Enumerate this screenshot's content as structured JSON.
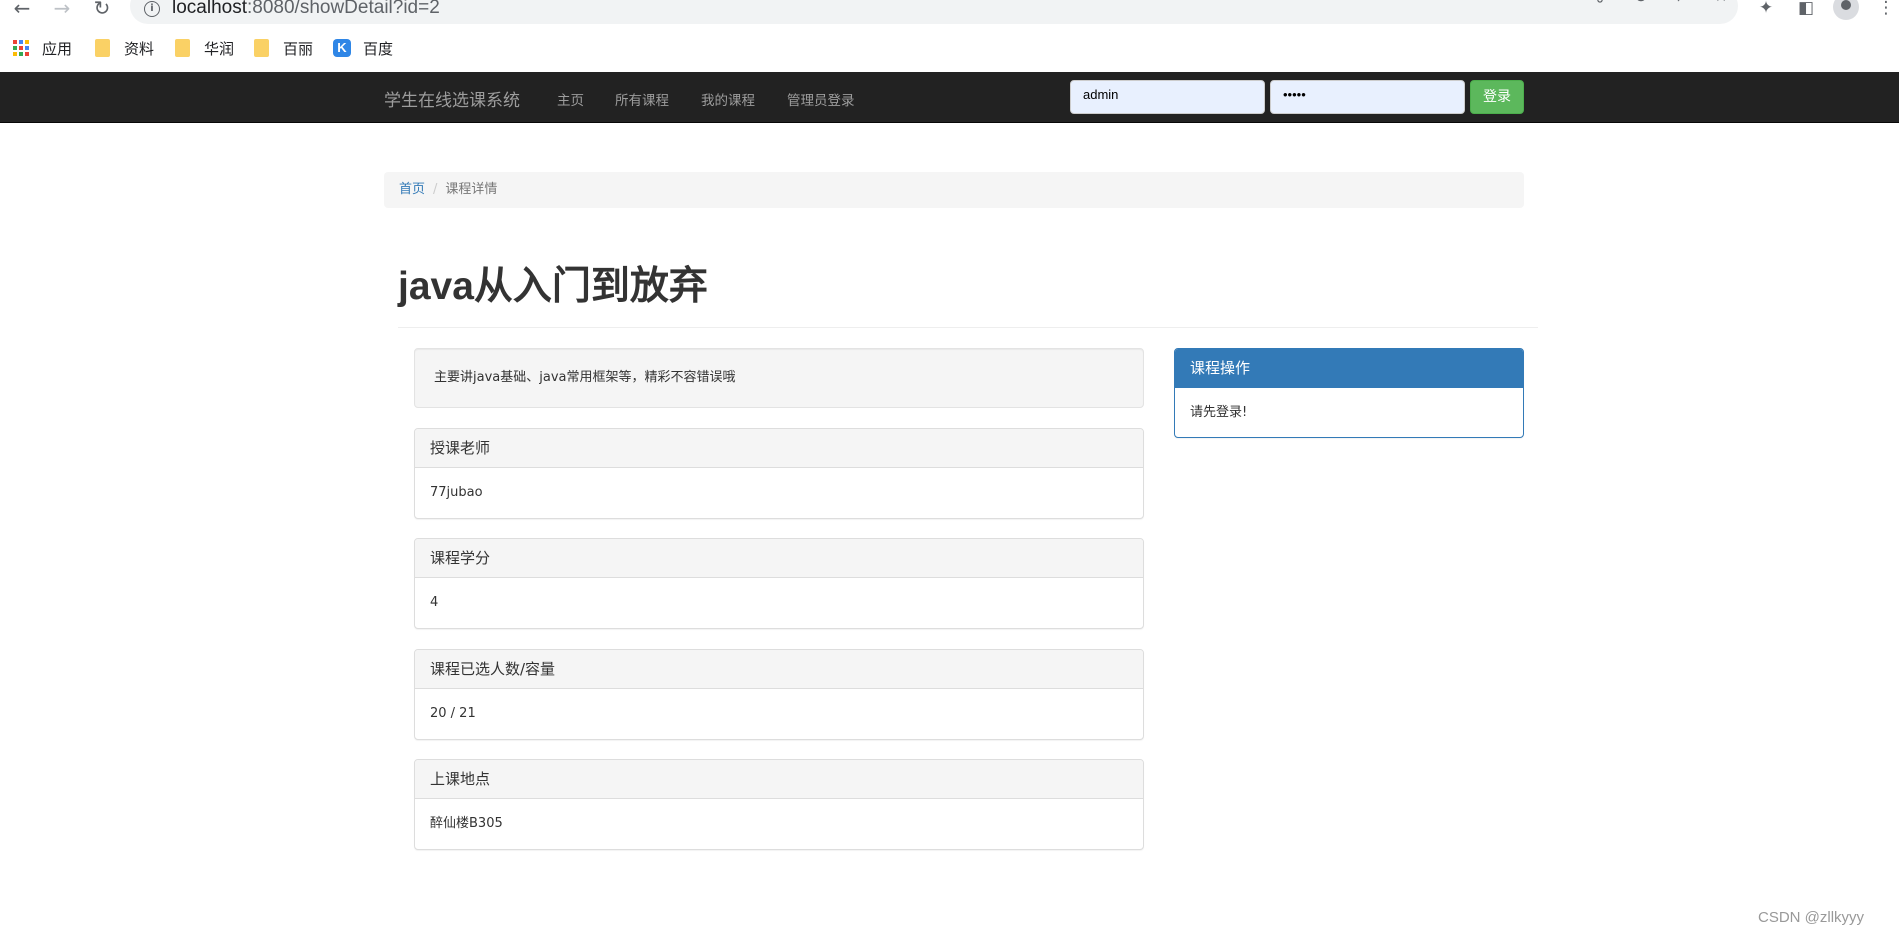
{
  "browser": {
    "url_host": "localhost",
    "url_rest": ":8080/showDetail?id=2",
    "bookmarks": [
      {
        "label": "应用",
        "icon": "apps-grid-icon"
      },
      {
        "label": "资料",
        "icon": "folder-icon"
      },
      {
        "label": "华润",
        "icon": "folder-icon"
      },
      {
        "label": "百丽",
        "icon": "folder-icon"
      },
      {
        "label": "百度",
        "icon": "k-logo-icon"
      }
    ]
  },
  "navbar": {
    "brand": "学生在线选课系统",
    "links": [
      "主页",
      "所有课程",
      "我的课程",
      "管理员登录"
    ],
    "username_value": "admin",
    "password_value": "•••••",
    "login_label": "登录"
  },
  "breadcrumb": {
    "home": "首页",
    "separator": "/",
    "current": "课程详情"
  },
  "course": {
    "title": "java从入门到放弃",
    "description": "主要讲java基础、java常用框架等，精彩不容错误哦",
    "panels": [
      {
        "heading": "授课老师",
        "value": "77jubao"
      },
      {
        "heading": "课程学分",
        "value": "4"
      },
      {
        "heading": "课程已选人数/容量",
        "value": "20 / 21"
      },
      {
        "heading": "上课地点",
        "value": "醉仙楼B305"
      }
    ]
  },
  "actions_panel": {
    "heading": "课程操作",
    "body": "请先登录!"
  },
  "watermark": "CSDN @zllkyyy",
  "colors": {
    "navbar_bg": "#222222",
    "primary": "#337ab7",
    "success": "#5cb85c",
    "link": "#337ab7"
  }
}
